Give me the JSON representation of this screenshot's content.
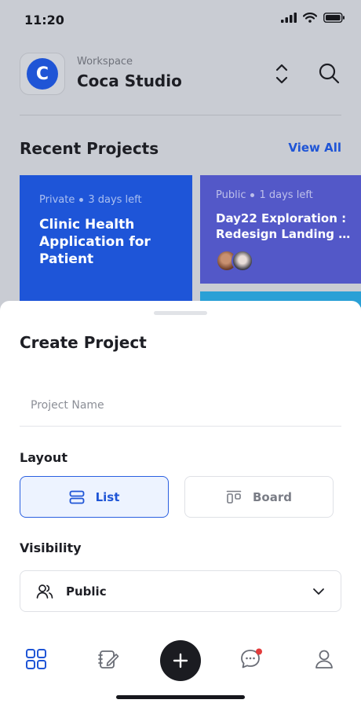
{
  "status_bar": {
    "time": "11:20"
  },
  "workspace": {
    "label": "Workspace",
    "name": "Coca Studio",
    "logo_letter": "C"
  },
  "recent": {
    "title": "Recent Projects",
    "view_all": "View All",
    "projects": [
      {
        "visibility": "Private",
        "due": "3 days left",
        "title": "Clinic Health Application for Patient",
        "color": "#1e55d8"
      },
      {
        "visibility": "Public",
        "due": "1 days left",
        "title_line1": "Day22 Exploration :",
        "title_line2": "Redesign Landing Page",
        "color": "#5358c8"
      }
    ]
  },
  "sheet": {
    "title": "Create Project",
    "project_name_placeholder": "Project Name",
    "layout_label": "Layout",
    "layout_options": {
      "list": "List",
      "board": "Board"
    },
    "selected_layout": "List",
    "visibility_label": "Visibility",
    "visibility_value": "Public"
  },
  "tabbar": {
    "icons": [
      "grid-icon",
      "notes-icon",
      "plus-icon",
      "chat-icon",
      "profile-icon"
    ]
  },
  "colors": {
    "accent": "#1f55d6",
    "fab": "#1b1c21",
    "notification_dot": "#e33b3b"
  }
}
